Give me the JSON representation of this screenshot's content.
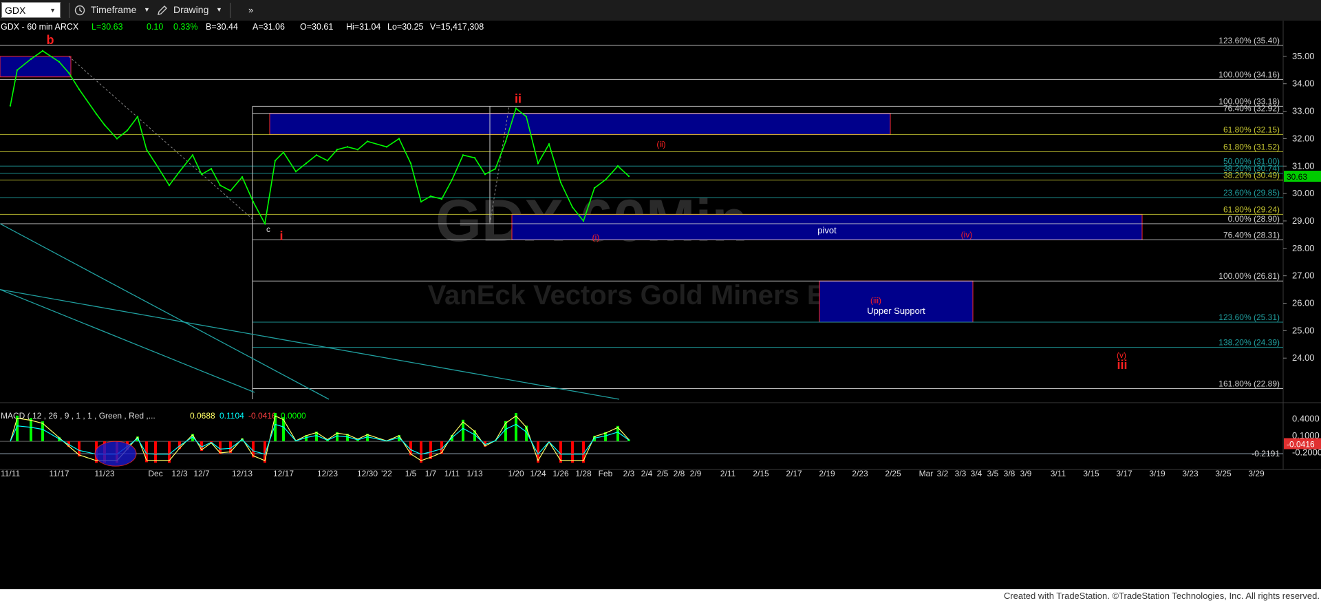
{
  "toolbar": {
    "symbol": "GDX",
    "timeframe_label": "Timeframe",
    "drawing_label": "Drawing",
    "more_label": "»"
  },
  "header": {
    "symbol_info": "GDX - 60 min  ARCX",
    "last": "L=30.63",
    "change": "0.10",
    "change_pct": "0.33%",
    "bid": "B=30.44",
    "ask": "A=31.06",
    "open": "O=30.61",
    "high": "Hi=31.04",
    "low": "Lo=30.25",
    "volume": "V=15,417,308"
  },
  "watermark": {
    "title": "GDX 60Min",
    "subtitle": "VanEck Vectors Gold Miners ETF"
  },
  "colors": {
    "background": "#000000",
    "price_line": "#00ff00",
    "box_fill": "#00008b",
    "box_border": "#ff2a2a",
    "wave_label": "#ff2020",
    "fib_white": "#d0d0d0",
    "fib_yellow": "#c8c832",
    "fib_teal": "#20a0a0",
    "macd_pos": "#00ff00",
    "macd_neg": "#ff0000",
    "last_price_tag": "#00cc00"
  },
  "chart_data": {
    "type": "line",
    "title": "GDX - 60 min",
    "ylim": [
      22.5,
      36.0
    ],
    "y_ticks": [
      "35.00",
      "34.00",
      "33.00",
      "32.00",
      "31.00",
      "30.00",
      "29.00",
      "28.00",
      "27.00",
      "26.00",
      "25.00",
      "24.00"
    ],
    "x_ticks": [
      "11/11",
      "11/17",
      "11/23",
      "Dec",
      "12/3",
      "12/7",
      "12/13",
      "12/17",
      "12/23",
      "12/30",
      "'22",
      "1/5",
      "1/7",
      "1/11",
      "1/13",
      "1/20",
      "1/24",
      "1/26",
      "1/28",
      "Feb",
      "2/3",
      "2/4",
      "2/5",
      "2/8",
      "2/9",
      "2/11",
      "2/15",
      "2/17",
      "2/19",
      "2/23",
      "2/25",
      "Mar",
      "3/2",
      "3/3",
      "3/4",
      "3/5",
      "3/8",
      "3/9",
      "3/11",
      "3/15",
      "3/17",
      "3/19",
      "3/23",
      "3/25",
      "3/29"
    ],
    "last_price": "30.63",
    "price_series": {
      "name": "GDX",
      "points": [
        [
          "11/11",
          33.2
        ],
        [
          "11/12",
          34.5
        ],
        [
          "11/15",
          34.9
        ],
        [
          "11/16",
          35.2
        ],
        [
          "11/17",
          34.8
        ],
        [
          "11/18",
          34.4
        ],
        [
          "11/19",
          33.8
        ],
        [
          "11/22",
          32.9
        ],
        [
          "11/23",
          32.5
        ],
        [
          "11/24",
          32.0
        ],
        [
          "11/26",
          32.3
        ],
        [
          "11/29",
          32.8
        ],
        [
          "11/30",
          31.6
        ],
        [
          "Dec",
          31.1
        ],
        [
          "12/2",
          30.3
        ],
        [
          "12/3",
          30.8
        ],
        [
          "12/6",
          31.4
        ],
        [
          "12/7",
          30.7
        ],
        [
          "12/8",
          30.9
        ],
        [
          "12/9",
          30.3
        ],
        [
          "12/10",
          30.1
        ],
        [
          "12/13",
          30.6
        ],
        [
          "12/14",
          29.7
        ],
        [
          "12/15",
          28.9
        ],
        [
          "12/16",
          31.2
        ],
        [
          "12/17",
          31.5
        ],
        [
          "12/20",
          30.8
        ],
        [
          "12/21",
          31.1
        ],
        [
          "12/22",
          31.4
        ],
        [
          "12/23",
          31.2
        ],
        [
          "12/27",
          31.6
        ],
        [
          "12/28",
          31.7
        ],
        [
          "12/29",
          31.6
        ],
        [
          "12/30",
          31.9
        ],
        [
          "'22",
          31.7
        ],
        [
          "1/4",
          32.0
        ],
        [
          "1/5",
          31.1
        ],
        [
          "1/6",
          29.7
        ],
        [
          "1/7",
          29.9
        ],
        [
          "1/10",
          29.8
        ],
        [
          "1/11",
          30.5
        ],
        [
          "1/12",
          31.4
        ],
        [
          "1/13",
          31.3
        ],
        [
          "1/14",
          30.7
        ],
        [
          "1/18",
          30.9
        ],
        [
          "1/19",
          31.9
        ],
        [
          "1/20",
          33.1
        ],
        [
          "1/21",
          32.8
        ],
        [
          "1/24",
          31.1
        ],
        [
          "1/25",
          31.8
        ],
        [
          "1/26",
          30.4
        ],
        [
          "1/27",
          29.5
        ],
        [
          "1/28",
          29.0
        ],
        [
          "1/31",
          30.2
        ],
        [
          "Feb",
          30.5
        ],
        [
          "2/2",
          31.0
        ],
        [
          "2/3",
          30.63
        ]
      ]
    },
    "fib_levels": [
      {
        "label": "123.60% (35.40)",
        "value": 35.4,
        "color": "white"
      },
      {
        "label": "100.00% (34.16)",
        "value": 34.16,
        "color": "white"
      },
      {
        "label": "100.00% (33.18)",
        "value": 33.18,
        "color": "white"
      },
      {
        "label": "76.40% (32.92)",
        "value": 32.92,
        "color": "white"
      },
      {
        "label": "61.80% (32.15)",
        "value": 32.15,
        "color": "yellow"
      },
      {
        "label": "61.80% (31.52)",
        "value": 31.52,
        "color": "yellow"
      },
      {
        "label": "50.00% (31.00)",
        "value": 31.0,
        "color": "teal"
      },
      {
        "label": "38.20% (30.74)",
        "value": 30.74,
        "color": "teal"
      },
      {
        "label": "38.20% (30.49)",
        "value": 30.49,
        "color": "yellow"
      },
      {
        "label": "23.60% (29.85)",
        "value": 29.85,
        "color": "teal"
      },
      {
        "label": "61.80% (29.24)",
        "value": 29.24,
        "color": "yellow"
      },
      {
        "label": "0.00% (28.90)",
        "value": 28.9,
        "color": "white"
      },
      {
        "label": "76.40% (28.31)",
        "value": 28.31,
        "color": "white"
      },
      {
        "label": "100.00% (26.81)",
        "value": 26.81,
        "color": "white"
      },
      {
        "label": "123.60% (25.31)",
        "value": 25.31,
        "color": "teal"
      },
      {
        "label": "138.20% (24.39)",
        "value": 24.39,
        "color": "teal"
      },
      {
        "label": "161.80% (22.89)",
        "value": 22.89,
        "color": "white"
      }
    ],
    "boxes": [
      {
        "label": "",
        "x_start": "11/11",
        "x_end": "11/19",
        "y_top": 35.0,
        "y_bottom": 34.25
      },
      {
        "label": "",
        "x_start": "12/17",
        "x_end": "2/24",
        "y_top": 32.92,
        "y_bottom": 32.15
      },
      {
        "label": "pivot",
        "x_start": "1/20",
        "x_end": "3/17",
        "y_top": 29.24,
        "y_bottom": 28.31
      },
      {
        "label": "Upper Support",
        "x_start": "2/19",
        "x_end": "3/2",
        "y_top": 26.81,
        "y_bottom": 25.31
      }
    ],
    "wave_labels": [
      {
        "text": "b",
        "x": "11/17",
        "y": 35.45
      },
      {
        "text": "c",
        "x": "12/15",
        "y": 28.6
      },
      {
        "text": "i",
        "x": "12/16",
        "y": 28.3
      },
      {
        "text": "ii",
        "x": "1/20",
        "y": 33.3
      },
      {
        "text": "(ii)",
        "x": "2/3",
        "y": 31.7
      },
      {
        "text": "(i)",
        "x": "1/28",
        "y": 28.3
      },
      {
        "text": "(iv)",
        "x": "3/4",
        "y": 28.4
      },
      {
        "text": "(iii)",
        "x": "2/23",
        "y": 26.0
      },
      {
        "text": "(v)",
        "x": "3/17",
        "y": 24.0
      },
      {
        "text": "iii",
        "x": "3/17",
        "y": 23.6
      }
    ],
    "macd": {
      "label": "MACD ( 12 , 26 , 9 , 1 , 1 , Green , Red ,...",
      "v1": "0.0688",
      "v2": "0.1104",
      "v3": "-0.0416",
      "v4": "0.0000",
      "y_ticks": [
        "0.4000",
        "0.1000",
        "-0.2000"
      ],
      "ref_value": "-0.2191",
      "last_value": "-0.0416",
      "ylim": [
        -0.45,
        0.55
      ]
    }
  },
  "footer": {
    "credit": "Created with TradeStation. ©TradeStation Technologies, Inc. All rights reserved."
  }
}
